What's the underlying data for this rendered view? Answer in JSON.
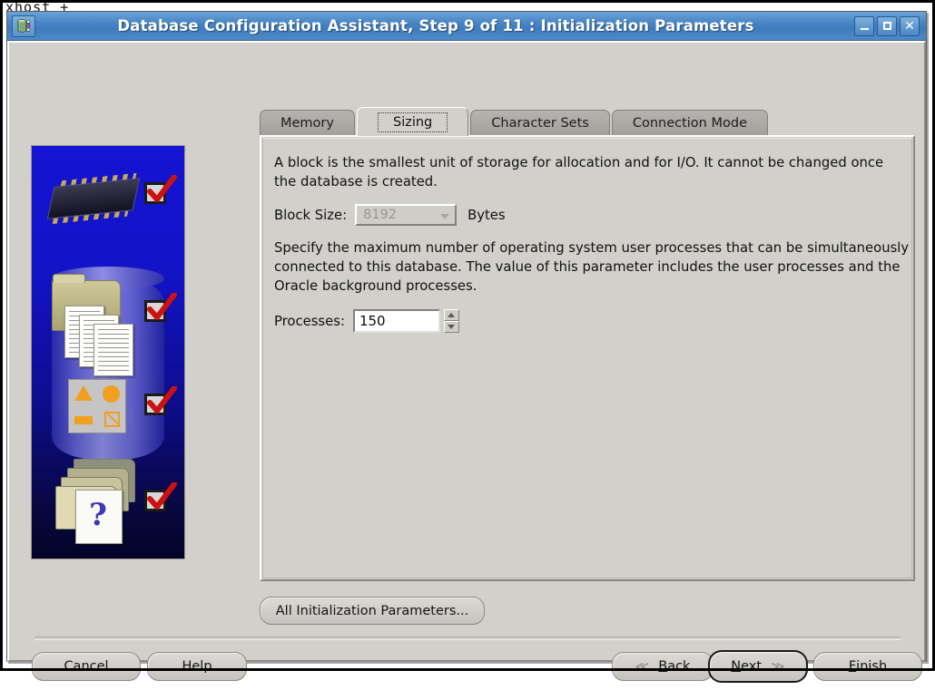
{
  "shell": {
    "text": "xhost +"
  },
  "titlebar": {
    "title": "Database Configuration Assistant, Step 9 of 11 : Initialization Parameters",
    "app_icon": "database-icon",
    "buttons": [
      {
        "name": "minimize-button",
        "label": "_"
      },
      {
        "name": "maximize-button",
        "label": "□"
      },
      {
        "name": "close-button",
        "label": "✕"
      }
    ],
    "accent_color": "#4a86c6"
  },
  "sidebar": {
    "stages": [
      {
        "icon": "chip-icon",
        "status": "checked"
      },
      {
        "icon": "folder-documents-icon",
        "status": "checked"
      },
      {
        "icon": "shapes-panel-icon",
        "status": "checked"
      },
      {
        "icon": "folders-question-icon",
        "status": "checked"
      }
    ],
    "check_color": "#cc1111",
    "background_color": "#1313c8"
  },
  "tabs": [
    {
      "label": "Memory",
      "selected": false
    },
    {
      "label": "Sizing",
      "selected": true
    },
    {
      "label": "Character Sets",
      "selected": false
    },
    {
      "label": "Connection Mode",
      "selected": false
    }
  ],
  "panel": {
    "paragraph1": "A block is the smallest unit of storage for allocation and for I/O. It cannot be changed once the database is created.",
    "block_size": {
      "label": "Block Size:",
      "value": "8192",
      "unit": "Bytes",
      "disabled": true
    },
    "paragraph2": "Specify the maximum number of operating system user processes that can be simultaneously connected to this database. The value of this parameter includes the user processes and the Oracle background processes.",
    "processes": {
      "label": "Processes:",
      "value": "150"
    },
    "all_params_button": "All Initialization Parameters..."
  },
  "footer": {
    "cancel": "Cancel",
    "help": "Help",
    "back": {
      "mnemonic": "B",
      "rest": "ack",
      "chevron": "≪"
    },
    "next": {
      "mnemonic": "N",
      "rest": "ext",
      "chevron": "≫",
      "is_default": true
    },
    "finish": {
      "mnemonic": "F",
      "rest": "inish"
    }
  }
}
